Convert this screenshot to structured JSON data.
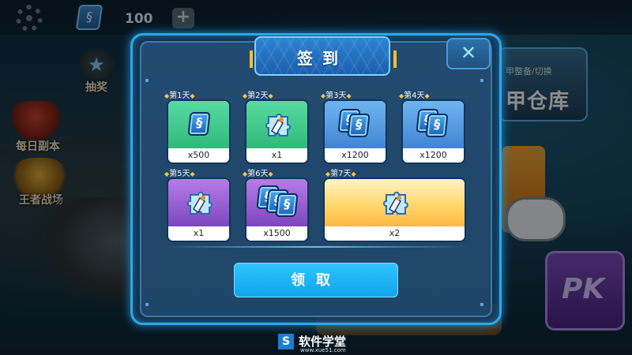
{
  "hud": {
    "coin_count": "100",
    "plus_label": "+"
  },
  "side": {
    "lottery_label": "抽奖",
    "daily_dungeon_label": "每日副本",
    "arena_label": "王者战场"
  },
  "right_panel": {
    "switch_label": "甲整备/切换",
    "warehouse_label": "甲仓库",
    "pk_label": "PK"
  },
  "dialog": {
    "title": "签到",
    "close_label": "✕",
    "days": [
      {
        "label": "第1天",
        "qty": "x500",
        "bg": "green"
      },
      {
        "label": "第2天",
        "qty": "x1",
        "bg": "green"
      },
      {
        "label": "第3天",
        "qty": "x1200",
        "bg": "blue"
      },
      {
        "label": "第4天",
        "qty": "x1200",
        "bg": "blue"
      },
      {
        "label": "第5天",
        "qty": "x1",
        "bg": "purple"
      },
      {
        "label": "第6天",
        "qty": "x1500",
        "bg": "purple"
      },
      {
        "label": "第7天",
        "qty": "x2",
        "bg": "gold"
      }
    ],
    "claim_label": "领取"
  },
  "watermark": {
    "logo": "S",
    "text": "软件学堂",
    "sub": "www.xue51.com"
  },
  "colors": {
    "accent": "#2ea7e8",
    "claim": "#18b3f5",
    "star": "#f6c342"
  }
}
